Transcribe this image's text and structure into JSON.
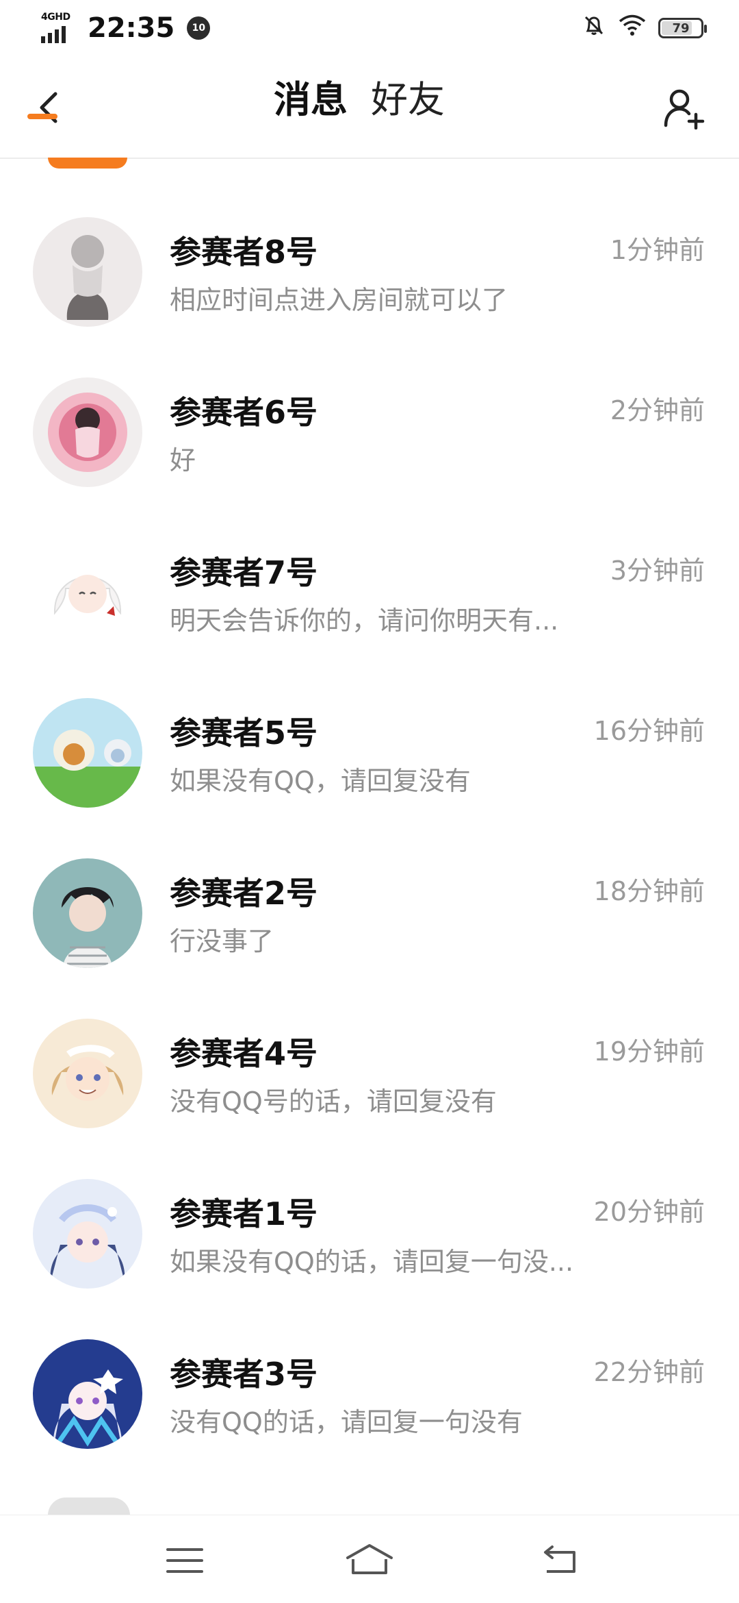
{
  "status_bar": {
    "network": "4GHD",
    "time": "22:35",
    "notification_count": "10",
    "battery_level": "79",
    "battery_level_fraction": 0.79
  },
  "header": {
    "tabs": [
      {
        "label": "消息",
        "active": true
      },
      {
        "label": "好友",
        "active": false
      }
    ]
  },
  "messages": [
    {
      "name": "参赛者8号",
      "time": "1分钟前",
      "preview": "相应时间点进入房间就可以了",
      "avatar": "avatar-icon"
    },
    {
      "name": "参赛者6号",
      "time": "2分钟前",
      "preview": "好",
      "avatar": "avatar-icon"
    },
    {
      "name": "参赛者7号",
      "time": "3分钟前",
      "preview": "明天会告诉你的，请问你明天有...",
      "avatar": "avatar-icon"
    },
    {
      "name": "参赛者5号",
      "time": "16分钟前",
      "preview": "如果没有QQ，请回复没有",
      "avatar": "avatar-icon"
    },
    {
      "name": "参赛者2号",
      "time": "18分钟前",
      "preview": "行没事了",
      "avatar": "avatar-icon"
    },
    {
      "name": "参赛者4号",
      "time": "19分钟前",
      "preview": "没有QQ号的话，请回复没有",
      "avatar": "avatar-icon"
    },
    {
      "name": "参赛者1号",
      "time": "20分钟前",
      "preview": "如果没有QQ的话，请回复一句没...",
      "avatar": "avatar-icon"
    },
    {
      "name": "参赛者3号",
      "time": "22分钟前",
      "preview": "没有QQ的话，请回复一句没有",
      "avatar": "avatar-icon"
    }
  ],
  "colors": {
    "accent": "#f57c1f",
    "name_text": "#111111",
    "secondary_text": "#8e8e8e",
    "divider": "#ececec"
  },
  "icons": {
    "back": "chevron-left-icon",
    "add_friend": "add-user-icon",
    "menu": "menu-icon",
    "home": "home-icon",
    "return": "return-icon"
  }
}
